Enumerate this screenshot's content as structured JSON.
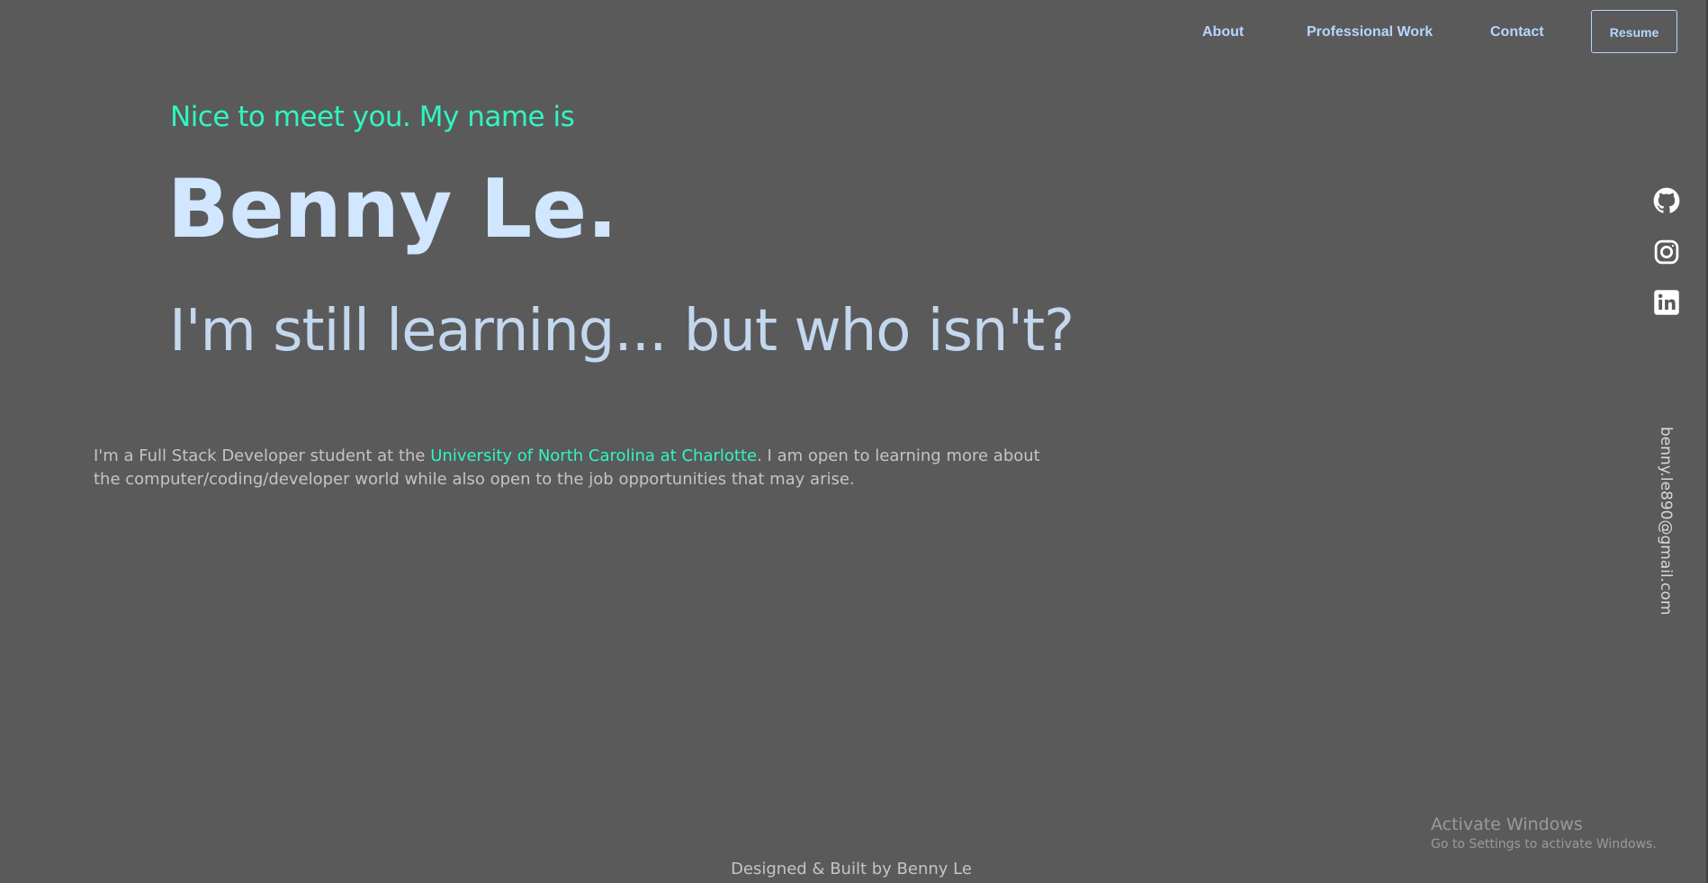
{
  "nav": {
    "about_label": "About",
    "work_label": "Professional Work",
    "contact_label": "Contact",
    "resume_label": "Resume"
  },
  "hero": {
    "greeting": "Nice to meet you. My name is",
    "name": "Benny Le.",
    "tagline": "I'm still learning... but who isn't?"
  },
  "bio": {
    "text_before": "I'm a Full Stack Developer student at the ",
    "link_text": "University of North Carolina at Charlotte",
    "text_after": ". I am open to learning more about the computer/coding/developer world while also open to the job opportunities that may arise."
  },
  "social": {
    "icons": [
      "github-icon",
      "instagram-icon",
      "linkedin-icon"
    ],
    "email": "benny.le890@gmail.com"
  },
  "watermark": {
    "title": "Activate Windows",
    "subtitle": "Go to Settings to activate Windows."
  },
  "footer": {
    "text": "Designed & Built by Benny Le"
  },
  "colors": {
    "background": "#5a5a5a",
    "accent": "#30f5c2",
    "heading": "#d1e6ff",
    "nav": "#b7d6ff",
    "body_text": "#c4c4c4"
  }
}
